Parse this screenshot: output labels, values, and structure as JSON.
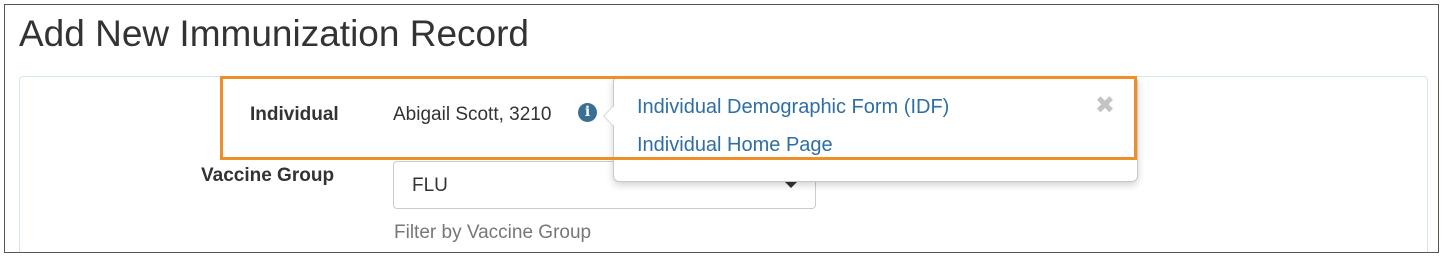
{
  "page": {
    "title": "Add New Immunization Record"
  },
  "form": {
    "individual": {
      "label": "Individual",
      "value": "Abigail Scott, 3210",
      "info_icon": "info-circle-icon"
    },
    "vaccine_group": {
      "label": "Vaccine Group",
      "selected": "FLU",
      "help_text": "Filter by Vaccine Group"
    }
  },
  "popover": {
    "links": [
      {
        "label": "Individual Demographic Form (IDF)"
      },
      {
        "label": "Individual Home Page"
      }
    ],
    "close_symbol": "✖"
  },
  "colors": {
    "highlight": "#ee8f2a",
    "link": "#2f6ea3",
    "info_icon": "#3b6f92"
  }
}
